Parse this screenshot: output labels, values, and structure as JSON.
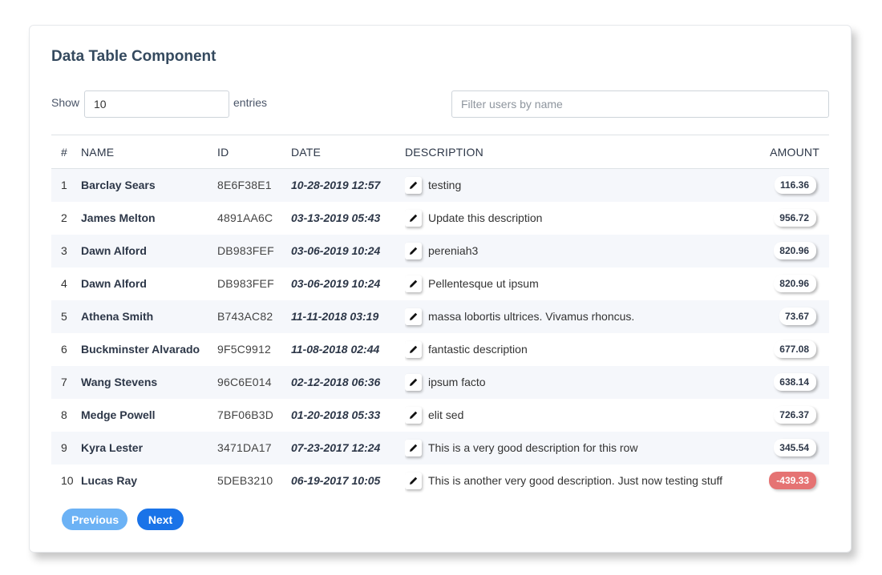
{
  "title": "Data Table Component",
  "controls": {
    "show_label": "Show",
    "show_value": "10",
    "entries_label": "entries",
    "filter_placeholder": "Filter users by name"
  },
  "columns": [
    "#",
    "NAME",
    "ID",
    "DATE",
    "DESCRIPTION",
    "AMOUNT"
  ],
  "rows": [
    {
      "num": "1",
      "name": "Barclay Sears",
      "id": "8E6F38E1",
      "date": "10-28-2019 12:57",
      "description": "testing",
      "amount": "116.36"
    },
    {
      "num": "2",
      "name": "James Melton",
      "id": "4891AA6C",
      "date": "03-13-2019 05:43",
      "description": "Update this description",
      "amount": "956.72"
    },
    {
      "num": "3",
      "name": "Dawn Alford",
      "id": "DB983FEF",
      "date": "03-06-2019 10:24",
      "description": "pereniah3",
      "amount": "820.96"
    },
    {
      "num": "4",
      "name": "Dawn Alford",
      "id": "DB983FEF",
      "date": "03-06-2019 10:24",
      "description": "Pellentesque ut ipsum",
      "amount": "820.96"
    },
    {
      "num": "5",
      "name": "Athena Smith",
      "id": "B743AC82",
      "date": "11-11-2018 03:19",
      "description": "massa lobortis ultrices. Vivamus rhoncus.",
      "amount": "73.67"
    },
    {
      "num": "6",
      "name": "Buckminster Alvarado",
      "id": "9F5C9912",
      "date": "11-08-2018 02:44",
      "description": "fantastic description",
      "amount": "677.08"
    },
    {
      "num": "7",
      "name": "Wang Stevens",
      "id": "96C6E014",
      "date": "02-12-2018 06:36",
      "description": "ipsum facto",
      "amount": "638.14"
    },
    {
      "num": "8",
      "name": "Medge Powell",
      "id": "7BF06B3D",
      "date": "01-20-2018 05:33",
      "description": "elit sed",
      "amount": "726.37"
    },
    {
      "num": "9",
      "name": "Kyra Lester",
      "id": "3471DA17",
      "date": "07-23-2017 12:24",
      "description": "This is a very good description for this row",
      "amount": "345.54"
    },
    {
      "num": "10",
      "name": "Lucas Ray",
      "id": "5DEB3210",
      "date": "06-19-2017 10:05",
      "description": "This is another very good description. Just now testing stuff",
      "amount": "-439.33"
    }
  ],
  "pagination": {
    "previous_label": "Previous",
    "next_label": "Next"
  },
  "colors": {
    "negative_badge": "#e57373",
    "previous_button": "#6cb2f5",
    "next_button": "#1a73e8",
    "stripe": "#f5f7fb"
  },
  "icons": {
    "edit": "pencil-icon"
  }
}
